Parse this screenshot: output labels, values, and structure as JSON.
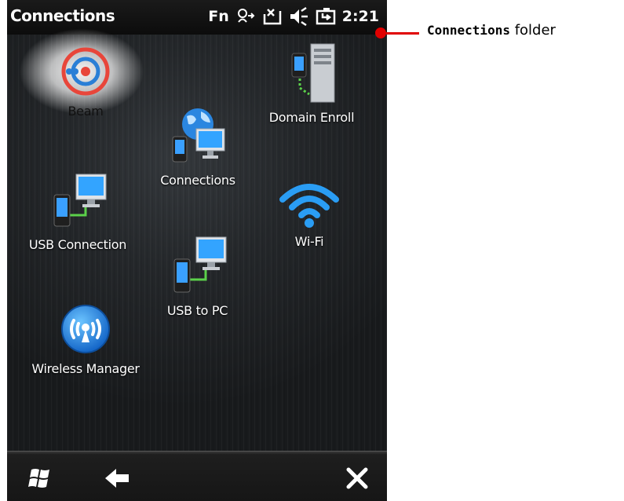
{
  "status_bar": {
    "title": "Connections",
    "fn_label": "Fn",
    "time": "2:21",
    "icons": [
      "connectivity-icon",
      "no-signal-icon",
      "speaker-muted-icon",
      "battery-icon"
    ]
  },
  "tiles": [
    {
      "label": "Beam",
      "icon": "beam-icon"
    },
    {
      "label": "Domain Enroll",
      "icon": "domain-enroll-icon"
    },
    {
      "label": "Connections",
      "icon": "connections-icon"
    },
    {
      "label": "USB Connection",
      "icon": "usb-connection-icon"
    },
    {
      "label": "Wi-Fi",
      "icon": "wifi-icon"
    },
    {
      "label": "USB to PC",
      "icon": "usb-to-pc-icon"
    },
    {
      "label": "Wireless Manager",
      "icon": "wireless-manager-icon"
    }
  ],
  "bottom_bar": {
    "icons": [
      "windows-start-icon",
      "back-arrow-icon",
      "close-icon"
    ]
  },
  "annotation": {
    "code": "Connections",
    "suffix": " folder",
    "color": "#e00000"
  }
}
